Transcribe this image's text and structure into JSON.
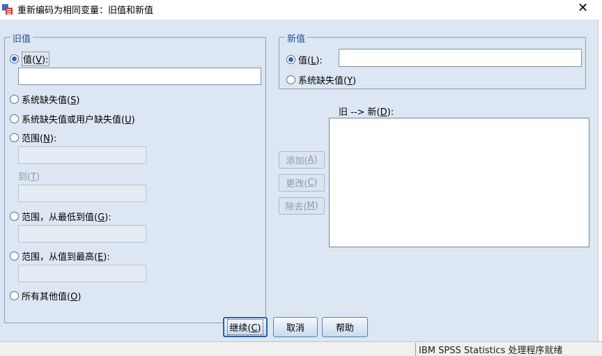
{
  "window": {
    "title": "重新编码为相同变量：旧值和新值",
    "close_glyph": "✕"
  },
  "old_value": {
    "legend": "旧值",
    "value_option": {
      "label": "值(",
      "key": "V",
      "suffix": "):"
    },
    "sysmis_option": {
      "label": "系统缺失值(",
      "key": "S",
      "suffix": ")"
    },
    "sysmis_user_option": {
      "label": "系统缺失值或用户缺失值(",
      "key": "U",
      "suffix": ")"
    },
    "range_option": {
      "label": "范围(",
      "key": "N",
      "suffix": "):"
    },
    "through_label": {
      "label": "到(",
      "key": "T",
      "suffix": ")"
    },
    "range_lowest_option": {
      "label": "范围，从最低到值(",
      "key": "G",
      "suffix": "):"
    },
    "range_highest_option": {
      "label": "范围，从值到最高(",
      "key": "E",
      "suffix": "):"
    },
    "all_other_option": {
      "label": "所有其他值(",
      "key": "O",
      "suffix": ")"
    }
  },
  "new_value": {
    "legend": "新值",
    "value_option": {
      "label": "值(",
      "key": "L",
      "suffix": "):"
    },
    "sysmis_option": {
      "label": "系统缺失值(",
      "key": "Y",
      "suffix": ")"
    }
  },
  "mapping": {
    "label": "旧 --> 新(",
    "key": "D",
    "suffix": "):"
  },
  "side_buttons": {
    "add": {
      "label": "添加(",
      "key": "A",
      "suffix": ")"
    },
    "change": {
      "label": "更改(",
      "key": "C",
      "suffix": ")"
    },
    "remove": {
      "label": "除去(",
      "key": "M",
      "suffix": ")"
    }
  },
  "footer": {
    "continue": {
      "label": "继续(",
      "key": "C",
      "suffix": ")"
    },
    "cancel": "取消",
    "help": "帮助"
  },
  "status_bar": {
    "text": "IBM SPSS Statistics 处理程序就绪"
  }
}
